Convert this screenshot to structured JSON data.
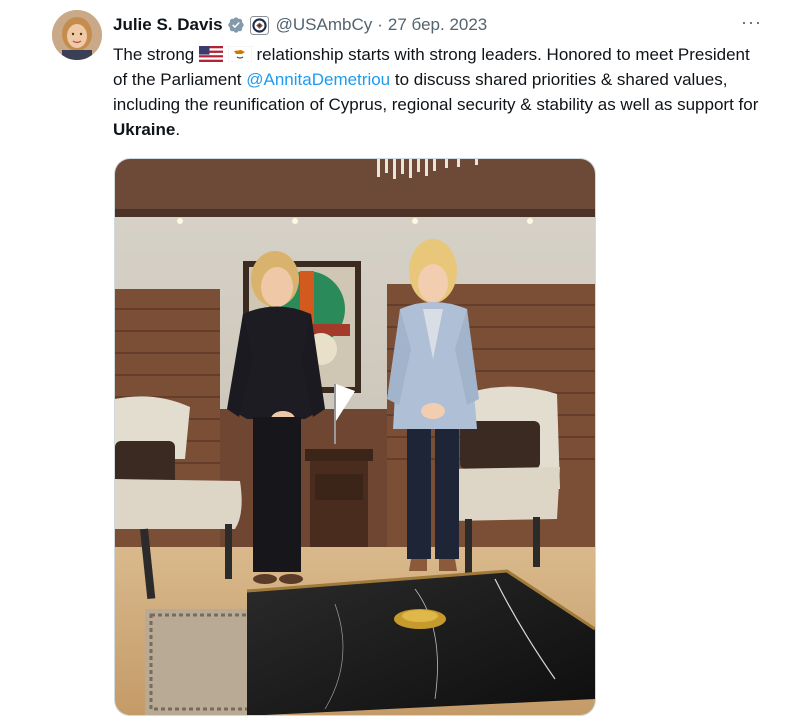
{
  "author": {
    "name": "Julie S. Davis",
    "handle": "@USAmbCy",
    "separator": "·",
    "date": "27 бер. 2023"
  },
  "menu": {
    "more_label": "···"
  },
  "tweet": {
    "part1": "The strong ",
    "part2": " relationship starts with strong leaders. Honored to meet President of the Parliament ",
    "mention": "@AnnitaDemetriou",
    "part3": " to discuss shared priorities & shared values, including the reunification of Cyprus, regional security & stability as well as support for ",
    "bold": "Ukraine",
    "part4": "."
  },
  "icons": {
    "verified": "verified-badge-icon",
    "affiliation": "state-department-seal-icon",
    "flag_us": "us-flag-icon",
    "flag_cy": "cyprus-flag-icon",
    "more": "more-options-icon"
  },
  "colors": {
    "link": "#1d9bf0",
    "verified": "#829aab",
    "muted": "#536471"
  }
}
